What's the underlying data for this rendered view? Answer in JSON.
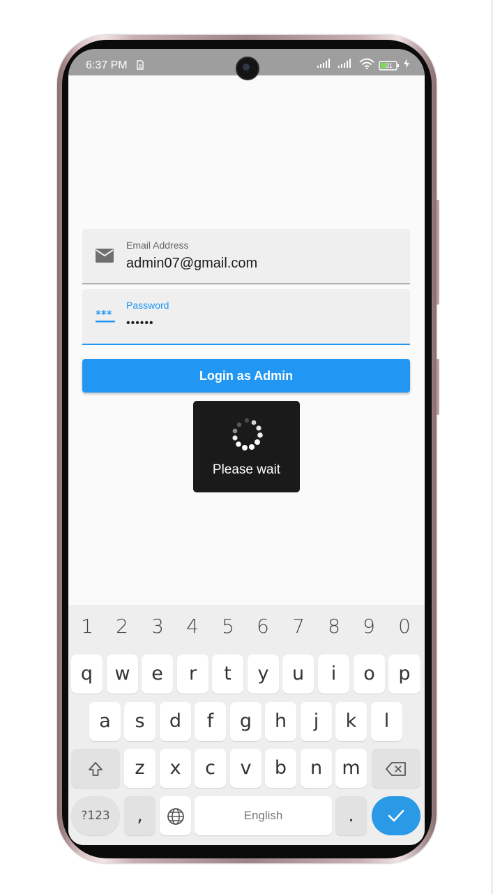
{
  "status_bar": {
    "time": "6:37 PM",
    "battery_level": "31",
    "icons": [
      "sim-icon",
      "signal-icon",
      "signal-icon",
      "wifi-icon",
      "battery-icon",
      "charging-icon"
    ]
  },
  "form": {
    "email": {
      "label": "Email Address",
      "value": "admin07@gmail.com",
      "icon": "mail-icon"
    },
    "password": {
      "label": "Password",
      "value": "••••••",
      "icon": "password-icon"
    },
    "login_button": "Login as Admin"
  },
  "dialog": {
    "text": "Please wait"
  },
  "keyboard": {
    "numbers": [
      "1",
      "2",
      "3",
      "4",
      "5",
      "6",
      "7",
      "8",
      "9",
      "0"
    ],
    "row1": [
      "q",
      "w",
      "e",
      "r",
      "t",
      "y",
      "u",
      "i",
      "o",
      "p"
    ],
    "row2": [
      "a",
      "s",
      "d",
      "f",
      "g",
      "h",
      "j",
      "k",
      "l"
    ],
    "row3": [
      "z",
      "x",
      "c",
      "v",
      "b",
      "n",
      "m"
    ],
    "symbols_label": "?123",
    "comma": ",",
    "space_label": "English",
    "period": "."
  },
  "colors": {
    "accent": "#2196f3",
    "status_bar": "#9e9e9e",
    "dialog": "#1a1a1a",
    "enter_key": "#2a9ae6"
  }
}
